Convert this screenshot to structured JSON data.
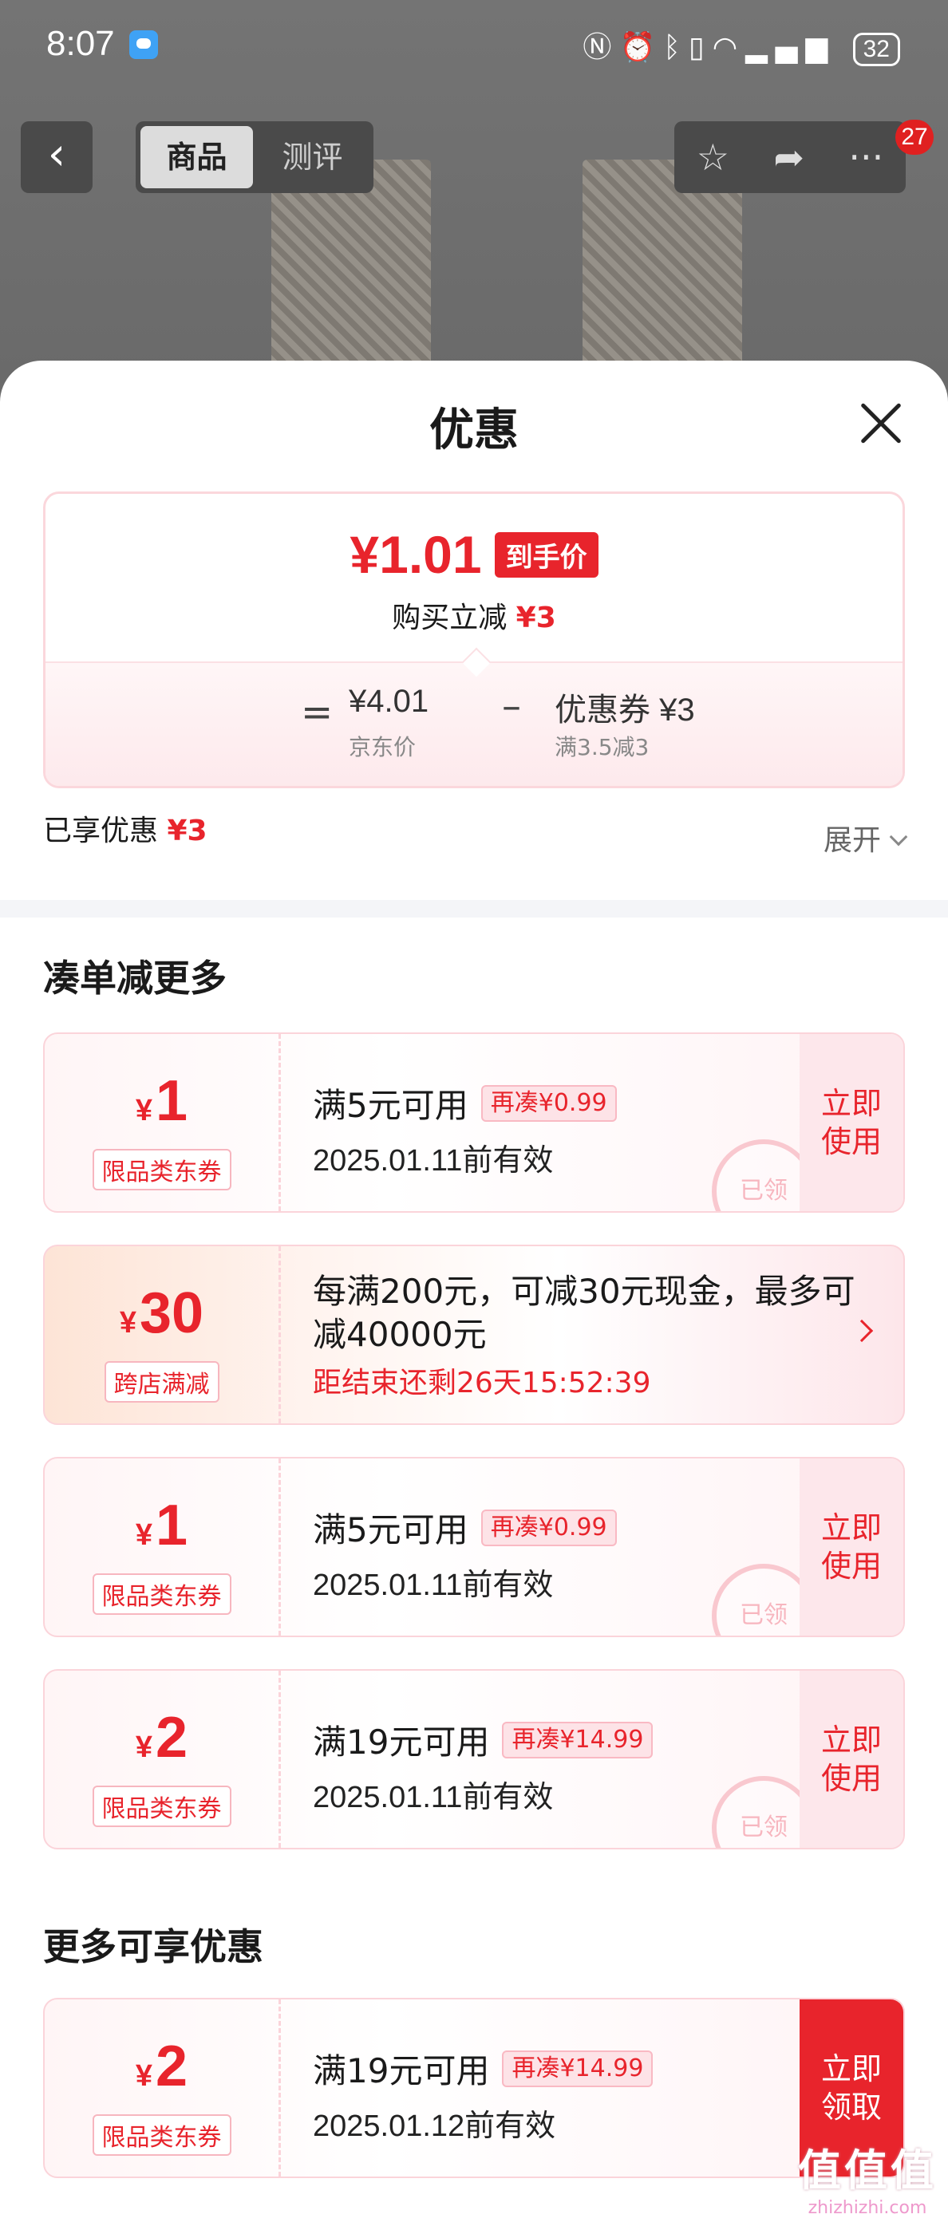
{
  "status_bar": {
    "time": "8:07",
    "battery": "32"
  },
  "nav": {
    "back": "‹",
    "tabs": [
      "商品",
      "测评"
    ],
    "cart_count": "27"
  },
  "sheet": {
    "title": "优惠",
    "price": {
      "final": "¥1.01",
      "tag": "到手价",
      "sub_label": "购买立减",
      "sub_amount": "¥3",
      "equals": "=",
      "jd_price": "¥4.01",
      "jd_label": "京东价",
      "minus": "–",
      "coupon_label": "优惠券 ¥3",
      "coupon_rule": "满3.5减3"
    },
    "enjoyed_label": "已享优惠",
    "enjoyed_amount": "¥3",
    "expand_label": "展开"
  },
  "section_more_orders": "凑单减更多",
  "coupons": [
    {
      "currency": "¥",
      "amount": "1",
      "kind": "限品类东券",
      "condition": "满5元可用",
      "chip": "再凑¥0.99",
      "expiry": "2025.01.11前有效",
      "action": "立即使用",
      "stamp": "已领"
    },
    {
      "currency": "¥",
      "amount": "1",
      "kind": "限品类东券",
      "condition": "满5元可用",
      "chip": "再凑¥0.99",
      "expiry": "2025.01.11前有效",
      "action": "立即使用",
      "stamp": "已领"
    },
    {
      "currency": "¥",
      "amount": "2",
      "kind": "限品类东券",
      "condition": "满19元可用",
      "chip": "再凑¥14.99",
      "expiry": "2025.01.11前有效",
      "action": "立即使用",
      "stamp": "已领"
    }
  ],
  "promo": {
    "currency": "¥",
    "amount": "30",
    "kind": "跨店满减",
    "desc": "每满200元，可减30元现金，最多可减40000元",
    "timer": "距结束还剩26天15:52:39"
  },
  "section_more_offers": "更多可享优惠",
  "extra_coupon": {
    "currency": "¥",
    "amount": "2",
    "kind": "限品类东券",
    "condition": "满19元可用",
    "chip": "再凑¥14.99",
    "expiry": "2025.01.12前有效",
    "action": "立即领取"
  },
  "watermark": {
    "big": "值值值",
    "small": "zhizhizhi.com"
  },
  "colors": {
    "accent": "#e8242c",
    "card_border": "#fbd4da"
  }
}
